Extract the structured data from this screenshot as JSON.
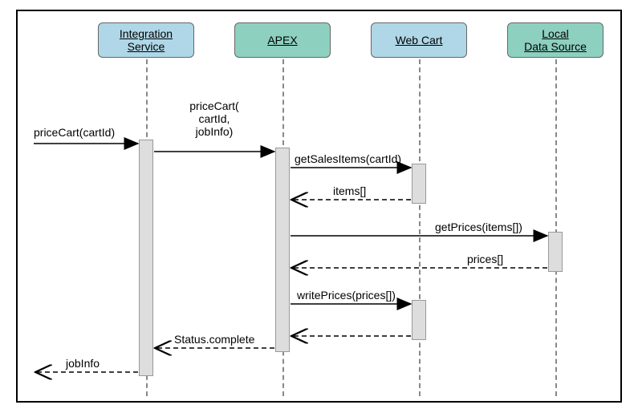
{
  "participants": {
    "integration": "Integration\nService",
    "apex": "APEX",
    "webcart": "Web Cart",
    "local": "Local\nData Source"
  },
  "messages": {
    "m1": "priceCart(cartId)",
    "m2": "priceCart(\ncartId,\njobInfo)",
    "m3": "getSalesItems(cartId)",
    "m4": "items[]",
    "m5": "getPrices(items[])",
    "m6": "prices[]",
    "m7": "writePrices(prices[])",
    "m8": "Status.complete",
    "m9": "jobInfo"
  }
}
